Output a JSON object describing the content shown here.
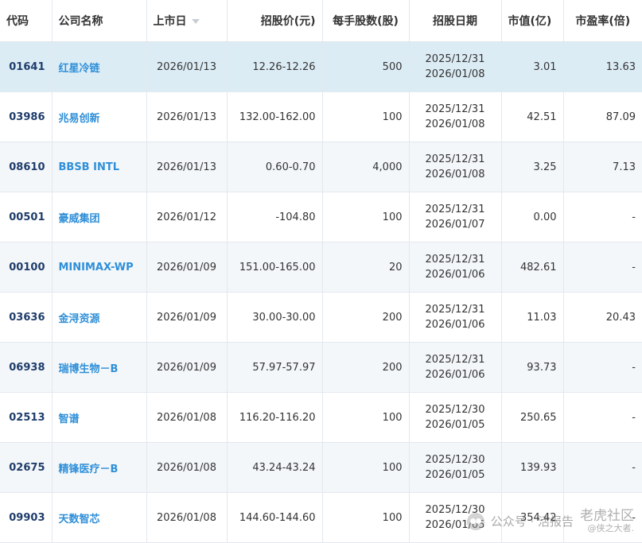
{
  "header": {
    "code": "代码",
    "name": "公司名称",
    "listing_date": "上市日",
    "offer_price": "招股价(元)",
    "lot_size": "每手股数(股)",
    "subscription_period": "招股日期",
    "market_cap": "市值(亿)",
    "pe_ratio": "市盈率(倍)"
  },
  "rows": [
    {
      "code": "01641",
      "name": "红星冷链",
      "listing_date": "2026/01/13",
      "offer_price": "12.26-12.26",
      "lot_size": "500",
      "sub_start": "2025/12/31",
      "sub_end": "2026/01/08",
      "market_cap": "3.01",
      "pe": "13.63"
    },
    {
      "code": "03986",
      "name": "兆易创新",
      "listing_date": "2026/01/13",
      "offer_price": "132.00-162.00",
      "lot_size": "100",
      "sub_start": "2025/12/31",
      "sub_end": "2026/01/08",
      "market_cap": "42.51",
      "pe": "87.09"
    },
    {
      "code": "08610",
      "name": "BBSB INTL",
      "listing_date": "2026/01/13",
      "offer_price": "0.60-0.70",
      "lot_size": "4,000",
      "sub_start": "2025/12/31",
      "sub_end": "2026/01/08",
      "market_cap": "3.25",
      "pe": "7.13"
    },
    {
      "code": "00501",
      "name": "豪威集团",
      "listing_date": "2026/01/12",
      "offer_price": "-104.80",
      "lot_size": "100",
      "sub_start": "2025/12/31",
      "sub_end": "2026/01/07",
      "market_cap": "0.00",
      "pe": "-"
    },
    {
      "code": "00100",
      "name": "MINIMAX-WP",
      "listing_date": "2026/01/09",
      "offer_price": "151.00-165.00",
      "lot_size": "20",
      "sub_start": "2025/12/31",
      "sub_end": "2026/01/06",
      "market_cap": "482.61",
      "pe": "-"
    },
    {
      "code": "03636",
      "name": "金浔资源",
      "listing_date": "2026/01/09",
      "offer_price": "30.00-30.00",
      "lot_size": "200",
      "sub_start": "2025/12/31",
      "sub_end": "2026/01/06",
      "market_cap": "11.03",
      "pe": "20.43"
    },
    {
      "code": "06938",
      "name": "瑞博生物－B",
      "listing_date": "2026/01/09",
      "offer_price": "57.97-57.97",
      "lot_size": "200",
      "sub_start": "2025/12/31",
      "sub_end": "2026/01/06",
      "market_cap": "93.73",
      "pe": "-"
    },
    {
      "code": "02513",
      "name": "智谱",
      "listing_date": "2026/01/08",
      "offer_price": "116.20-116.20",
      "lot_size": "100",
      "sub_start": "2025/12/30",
      "sub_end": "2026/01/05",
      "market_cap": "250.65",
      "pe": "-"
    },
    {
      "code": "02675",
      "name": "精锋医疗－B",
      "listing_date": "2026/01/08",
      "offer_price": "43.24-43.24",
      "lot_size": "100",
      "sub_start": "2025/12/30",
      "sub_end": "2026/01/05",
      "market_cap": "139.93",
      "pe": "-"
    },
    {
      "code": "09903",
      "name": "天数智芯",
      "listing_date": "2026/01/08",
      "offer_price": "144.60-144.60",
      "lot_size": "100",
      "sub_start": "2025/12/30",
      "sub_end": "2026/01/05",
      "market_cap": "354.42",
      "pe": "-"
    }
  ],
  "watermark": {
    "public_account": "公众号 · 活报告",
    "brand_top": "老虎社区",
    "brand_bottom": "@侠之大者."
  },
  "colors": {
    "code_text": "#1f3d6b",
    "name_link": "#2f8fd8",
    "selected_row_bg": "#dcecf5",
    "alt_row_bg": "#f4f7fa"
  },
  "icons": {
    "sort": "sort-down-icon",
    "watermark": "wechat-icon"
  }
}
